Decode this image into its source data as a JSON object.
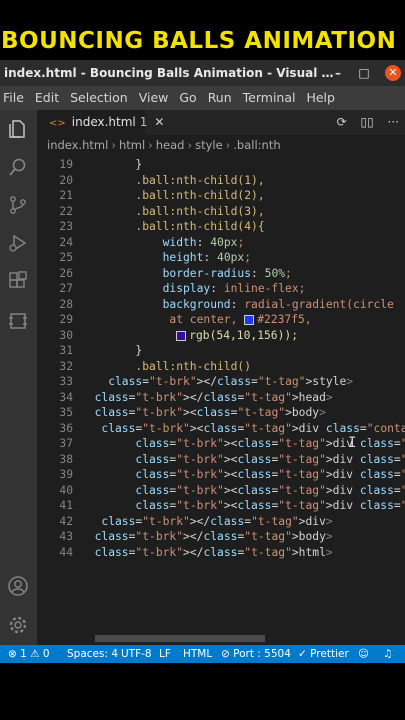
{
  "banner": {
    "text": "BOUNCING BALLS ANIMATION"
  },
  "window": {
    "title": "index.html - Bouncing Balls Animation - Visual Studio...",
    "minimize": "–",
    "maximize": "□",
    "close": "✕"
  },
  "menu": [
    "File",
    "Edit",
    "Selection",
    "View",
    "Go",
    "Run",
    "Terminal",
    "Help"
  ],
  "activity_icons": [
    "explorer-icon",
    "search-icon",
    "source-control-icon",
    "run-debug-icon",
    "extensions-icon",
    "remote-icon",
    "account-icon",
    "settings-gear-icon"
  ],
  "tab": {
    "mark": "<>",
    "name": "index.html",
    "badge": "1",
    "close": "✕"
  },
  "tab_actions": [
    "⟳",
    "▯▯",
    "···"
  ],
  "breadcrumbs": [
    "index.html",
    "html",
    "head",
    "style",
    ".ball:nth"
  ],
  "code_lines": [
    {
      "n": "19",
      "indent": "        ",
      "text": "}"
    },
    {
      "n": "20",
      "indent": "        ",
      "text": ".ball:nth-child(1),"
    },
    {
      "n": "21",
      "indent": "        ",
      "text": ".ball:nth-child(2),"
    },
    {
      "n": "22",
      "indent": "        ",
      "text": ".ball:nth-child(3),"
    },
    {
      "n": "23",
      "indent": "        ",
      "text": ".ball:nth-child(4){"
    },
    {
      "n": "24",
      "indent": "            ",
      "text": "width: 40px;"
    },
    {
      "n": "25",
      "indent": "            ",
      "text": "height: 40px;"
    },
    {
      "n": "26",
      "indent": "            ",
      "text": "border-radius: 50%;"
    },
    {
      "n": "27",
      "indent": "            ",
      "text": "display: inline-flex;"
    },
    {
      "n": "28",
      "indent": "            ",
      "text": "background: radial-gradient(circle"
    },
    {
      "n": "29",
      "indent": "             ",
      "text": "at center, #2237f5,"
    },
    {
      "n": "30",
      "indent": "              ",
      "text": "rgb(54,10,156));"
    },
    {
      "n": "31",
      "indent": "        ",
      "text": "}"
    },
    {
      "n": "32",
      "indent": "        ",
      "text": ".ball:nth-child()"
    },
    {
      "n": "33",
      "indent": "    ",
      "text": "</style>"
    },
    {
      "n": "34",
      "indent": "  ",
      "text": "</head>"
    },
    {
      "n": "35",
      "indent": "  ",
      "text": "<body>"
    },
    {
      "n": "36",
      "indent": "   ",
      "text": "<div class=\"container\">"
    },
    {
      "n": "37",
      "indent": "        ",
      "text": "<div class=\"ball\"></div>"
    },
    {
      "n": "38",
      "indent": "        ",
      "text": "<div class=\"ball\"></div>"
    },
    {
      "n": "39",
      "indent": "        ",
      "text": "<div class=\"ball\"></div>"
    },
    {
      "n": "40",
      "indent": "        ",
      "text": "<div class=\"ball\"></div>"
    },
    {
      "n": "41",
      "indent": "        ",
      "text": "<div class=\"ball\"></div>"
    },
    {
      "n": "42",
      "indent": "   ",
      "text": "</div>"
    },
    {
      "n": "43",
      "indent": "  ",
      "text": "</body>"
    },
    {
      "n": "44",
      "indent": "  ",
      "text": "</html>"
    }
  ],
  "status": {
    "problems": "⊗ 1 ⚠ 0",
    "spaces": "Spaces: 4",
    "encoding": "UTF-8",
    "eol": "LF",
    "language": "HTML",
    "port": "⊘ Port : 5504",
    "prettier": "✓ Prettier"
  },
  "colors": {
    "banner": "#f2e200",
    "statusbar": "#007acc",
    "swatch_1": "#2237f5",
    "swatch_2": "#360a9c"
  }
}
